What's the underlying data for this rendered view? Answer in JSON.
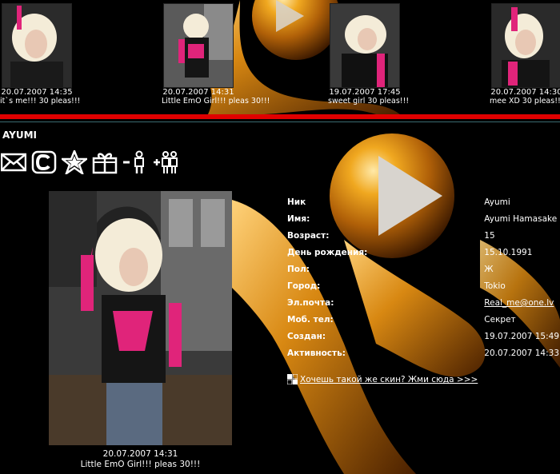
{
  "recent_photos": [
    {
      "date": "20.07.2007 14:35",
      "caption": "it`s me!!! 30 pleas!!!"
    },
    {
      "date": "20.07.2007 14:31",
      "caption": "Little EmO Girl!!! pleas 30!!!"
    },
    {
      "date": "19.07.2007 17:45",
      "caption": "sweet girl 30 pleas!!!"
    },
    {
      "date": "20.07.2007 14:30",
      "caption": "mee XD 30 pleas!!!"
    }
  ],
  "profile": {
    "username": "AYUMI",
    "photo": {
      "date": "20.07.2007 14:31",
      "caption": "Little EmO Girl!!! pleas 30!!!"
    },
    "fields": [
      {
        "label": "Ник",
        "value": "Ayumi"
      },
      {
        "label": "Имя:",
        "value": "Ayumi Hamasake"
      },
      {
        "label": "Возраст:",
        "value": "15"
      },
      {
        "label": "День рождения:",
        "value": "15.10.1991"
      },
      {
        "label": "Пол:",
        "value": "Ж"
      },
      {
        "label": "Город:",
        "value": "Tokio"
      },
      {
        "label": "Эл.почта:",
        "value": "Real_me@one.lv"
      },
      {
        "label": "Моб. тел:",
        "value": "Секрет"
      },
      {
        "label": "Создан:",
        "value": "19.07.2007 15:49"
      },
      {
        "label": "Активность:",
        "value": "20.07.2007 14:33"
      }
    ]
  },
  "actions": [
    {
      "name": "send-message",
      "icon": "envelope-icon"
    },
    {
      "name": "copyright",
      "icon": "letter-c-icon"
    },
    {
      "name": "favorite",
      "icon": "star-icon"
    },
    {
      "name": "gift",
      "icon": "gift-icon"
    },
    {
      "name": "remove-friend",
      "icon": "person-minus-icon"
    },
    {
      "name": "add-friend",
      "icon": "people-plus-icon"
    }
  ],
  "skin_link": "Хочешь такой же скин? Жми сюда >>>",
  "colors": {
    "background": "#000000",
    "accent_line": "#e00000",
    "amber": "#d08a10"
  }
}
